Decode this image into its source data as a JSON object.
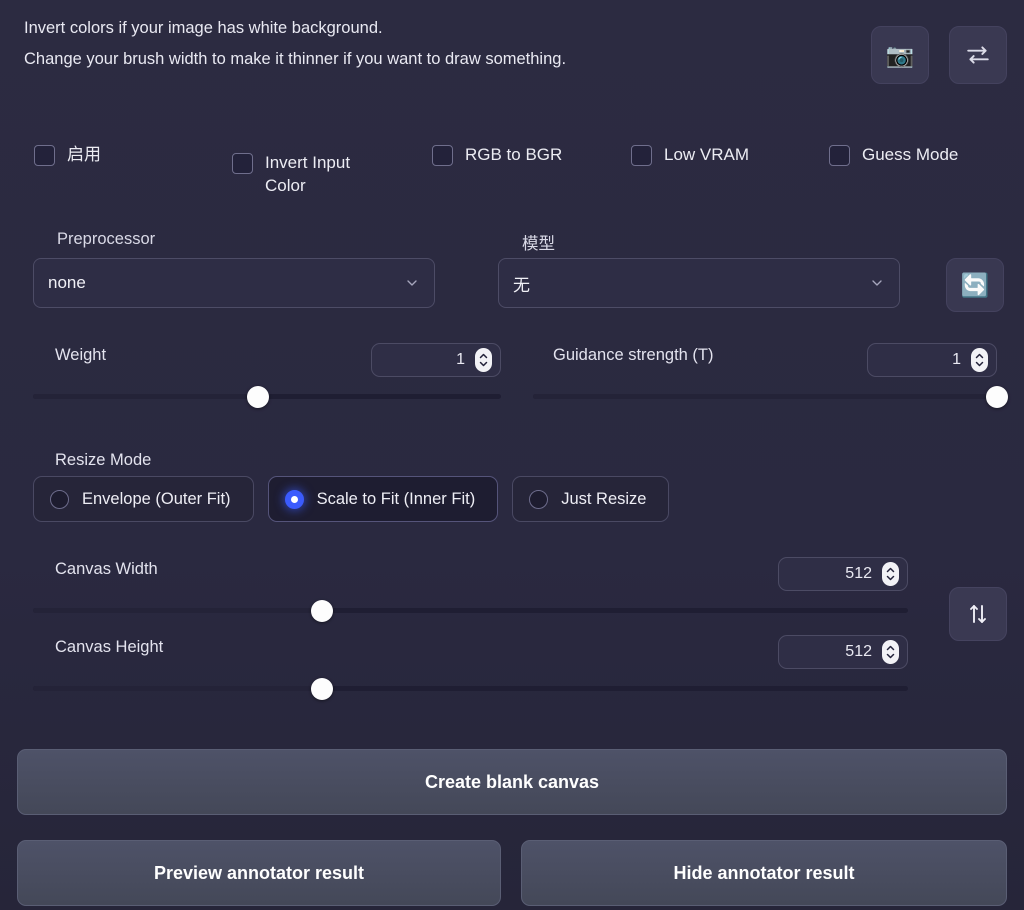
{
  "header": {
    "hint_line_1": "Invert colors if your image has white background.",
    "hint_line_2": "Change your brush width to make it thinner if you want to draw something.",
    "camera_icon": "camera-icon",
    "swap_icon": "swap-horizontal-icon"
  },
  "checkboxes": [
    {
      "label": "启用",
      "checked": false,
      "name": "enable"
    },
    {
      "label": "Invert Input Color",
      "checked": false,
      "name": "invert-input-color"
    },
    {
      "label": "RGB to BGR",
      "checked": false,
      "name": "rgb-to-bgr"
    },
    {
      "label": "Low VRAM",
      "checked": false,
      "name": "low-vram"
    },
    {
      "label": "Guess Mode",
      "checked": false,
      "name": "guess-mode"
    }
  ],
  "preprocessor": {
    "label": "Preprocessor",
    "value": "none"
  },
  "model": {
    "label": "模型",
    "value": "无",
    "refresh_icon": "refresh-icon"
  },
  "weight": {
    "label": "Weight",
    "value": "1",
    "percent": 48
  },
  "guidance": {
    "label": "Guidance strength (T)",
    "value": "1",
    "percent": 100
  },
  "resize_mode": {
    "label": "Resize Mode",
    "options": [
      {
        "label": "Envelope (Outer Fit)",
        "selected": false
      },
      {
        "label": "Scale to Fit (Inner Fit)",
        "selected": true
      },
      {
        "label": "Just Resize",
        "selected": false
      }
    ]
  },
  "canvas_width": {
    "label": "Canvas Width",
    "value": "512",
    "percent": 33
  },
  "canvas_height": {
    "label": "Canvas Height",
    "value": "512",
    "percent": 33
  },
  "swap_dimensions": {
    "icon": "swap-vertical-icon"
  },
  "buttons": {
    "create_blank_canvas": "Create blank canvas",
    "preview_annotator": "Preview annotator result",
    "hide_annotator": "Hide annotator result"
  },
  "colors": {
    "background": "#2b2a3f",
    "accent_blue": "#3b5bfd",
    "button_gray": "#4a4e63",
    "text": "#e8e8f0"
  }
}
